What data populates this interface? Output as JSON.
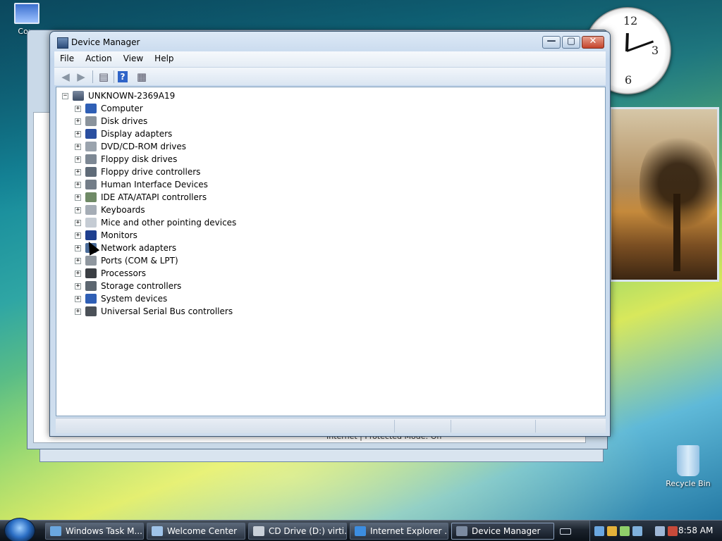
{
  "desktop": {
    "icons": [
      {
        "label": "Com"
      },
      {
        "label": "Recycle Bin"
      }
    ]
  },
  "background_window": {
    "status_text": "Internet | Protected Mode: On"
  },
  "window": {
    "title": "Device Manager",
    "controls": {
      "minimize": "—",
      "maximize": "▢",
      "close": "✕"
    },
    "menu": [
      "File",
      "Action",
      "View",
      "Help"
    ],
    "toolbar": {
      "back": "◀",
      "forward": "▶",
      "help": "?"
    }
  },
  "tree": {
    "root": "UNKNOWN-2369A19",
    "root_expander": "−",
    "expander": "+",
    "items": [
      {
        "label": "Computer",
        "icon": "computer-icon",
        "color": "#2f5fb5"
      },
      {
        "label": "Disk drives",
        "icon": "disk-drive-icon",
        "color": "#8a939c"
      },
      {
        "label": "Display adapters",
        "icon": "display-adapter-icon",
        "color": "#2a4fa0"
      },
      {
        "label": "DVD/CD-ROM drives",
        "icon": "dvd-drive-icon",
        "color": "#9aa3ad"
      },
      {
        "label": "Floppy disk drives",
        "icon": "floppy-drive-icon",
        "color": "#7d8894"
      },
      {
        "label": "Floppy drive controllers",
        "icon": "floppy-controller-icon",
        "color": "#5f6b78"
      },
      {
        "label": "Human Interface Devices",
        "icon": "hid-icon",
        "color": "#737d88"
      },
      {
        "label": "IDE ATA/ATAPI controllers",
        "icon": "ide-controller-icon",
        "color": "#6f8a66"
      },
      {
        "label": "Keyboards",
        "icon": "keyboard-icon",
        "color": "#a5adb6"
      },
      {
        "label": "Mice and other pointing devices",
        "icon": "mouse-icon",
        "color": "#c5ccd4"
      },
      {
        "label": "Monitors",
        "icon": "monitor-icon",
        "color": "#1e3f8f"
      },
      {
        "label": "Network adapters",
        "icon": "network-adapter-icon",
        "color": "#4a6c9a"
      },
      {
        "label": "Ports (COM & LPT)",
        "icon": "port-icon",
        "color": "#8f979f"
      },
      {
        "label": "Processors",
        "icon": "processor-icon",
        "color": "#3b3f44"
      },
      {
        "label": "Storage controllers",
        "icon": "storage-controller-icon",
        "color": "#5c6670"
      },
      {
        "label": "System devices",
        "icon": "system-device-icon",
        "color": "#2f5fb5"
      },
      {
        "label": "Universal Serial Bus controllers",
        "icon": "usb-icon",
        "color": "#4b5158"
      }
    ]
  },
  "taskbar": {
    "items": [
      {
        "label": "Windows Task M...",
        "icon": "task-manager-icon",
        "color": "#6aa7e0"
      },
      {
        "label": "Welcome Center",
        "icon": "welcome-center-icon",
        "color": "#9fc3e8"
      },
      {
        "label": "CD Drive (D:) virti...",
        "icon": "cd-drive-icon",
        "color": "#c9d0d8"
      },
      {
        "label": "Internet Explorer ...",
        "icon": "internet-explorer-icon",
        "color": "#3c8de0"
      },
      {
        "label": "Device Manager",
        "icon": "device-manager-icon",
        "color": "#7b8aa0",
        "active": true
      }
    ],
    "time": "8:58 AM"
  }
}
